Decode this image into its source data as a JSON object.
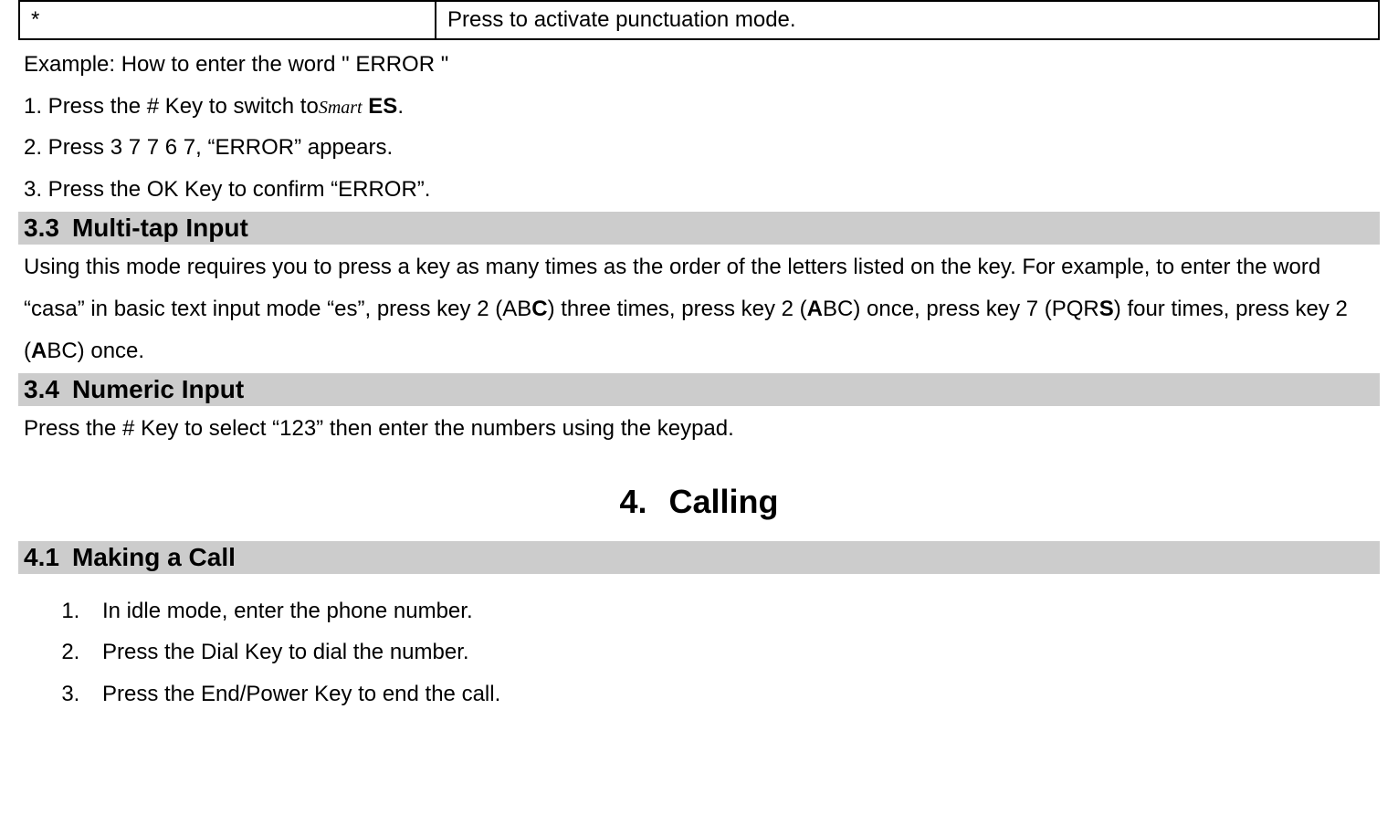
{
  "table": {
    "key": "*",
    "desc": "Press to activate punctuation mode."
  },
  "example": {
    "title": "Example: How to enter the word \" ERROR \"",
    "step1_a": "1. Press the # Key to switch to",
    "step1_icon": "Smart",
    "step1_b": " ES",
    "step1_c": ".",
    "step2": "2. Press 3 7 7 6 7, “ERROR” appears.",
    "step3": "3. Press the OK Key to confirm “ERROR”."
  },
  "sec33": {
    "num": "3.3",
    "title": "Multi-tap Input",
    "body_a": "Using this mode requires you to press a key as many times as the order of the letters listed on the key. For example, to enter the word “casa” in basic text input mode “es”, press key 2 (AB",
    "body_b": "C",
    "body_c": ") three times, press key 2 (",
    "body_d": "A",
    "body_e": "BC) once, press key 7 (PQR",
    "body_f": "S",
    "body_g": ") four times, press key 2 (",
    "body_h": "A",
    "body_i": "BC) once."
  },
  "sec34": {
    "num": "3.4",
    "title": "Numeric Input",
    "body": "Press the # Key to select “123” then enter the numbers using the keypad."
  },
  "chapter4": {
    "num": "4.",
    "title": "Calling"
  },
  "sec41": {
    "num": "4.1",
    "title": "Making a Call",
    "items": [
      "In idle mode, enter the phone number.",
      "Press the Dial Key to dial the number.",
      "Press the End/Power Key to end the call."
    ]
  }
}
